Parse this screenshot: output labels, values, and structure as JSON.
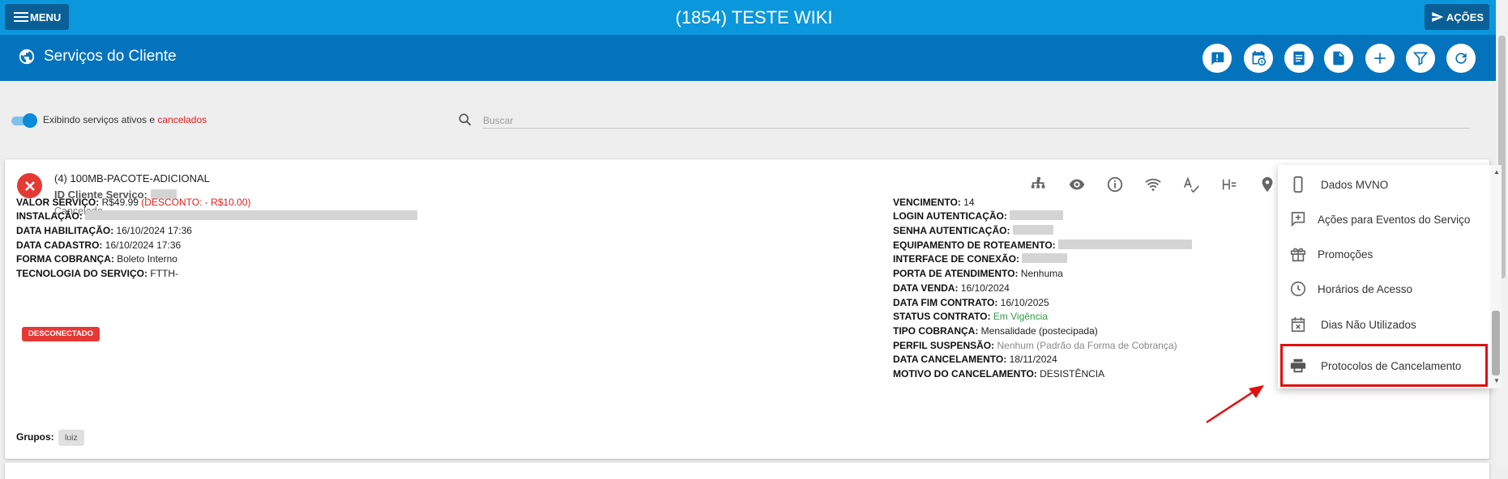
{
  "app": {
    "title": "(1854) TESTE WIKI",
    "menu_label": "MENU",
    "actions_label": "AÇÕES"
  },
  "page": {
    "title": "Serviços do Cliente"
  },
  "header_actions": [
    "alert-comment-icon",
    "calendar-clock-icon",
    "notes-icon",
    "document-icon",
    "add-icon",
    "filter-icon",
    "refresh-icon"
  ],
  "filter": {
    "toggle_text": "Exibindo serviços ativos e ",
    "toggle_text_highlight": "cancelados",
    "toggle_on": true
  },
  "search": {
    "placeholder": "Buscar"
  },
  "service": {
    "name": "(4) 100MB-PACOTE-ADICIONAL",
    "id_label": "ID Cliente Serviço:",
    "status": "Cancelado",
    "badge": "DESCONECTADO",
    "groups_label": "Grupos:",
    "groups": [
      "luiz"
    ],
    "card_actions": [
      "network-tree-icon",
      "eye-icon",
      "info-icon",
      "wifi-icon",
      "spellcheck-icon",
      "format-header-icon",
      "map-marker-icon"
    ],
    "left_fields": [
      {
        "label": "VALOR SERVIÇO:",
        "value": "R$49.99",
        "extra": "(DESCONTO: - R$10.00)"
      },
      {
        "label": "INSTALAÇÃO:",
        "value": ""
      },
      {
        "label": "DATA HABILITAÇÃO:",
        "value": "16/10/2024 17:36"
      },
      {
        "label": "DATA CADASTRO:",
        "value": "16/10/2024 17:36"
      },
      {
        "label": "FORMA COBRANÇA:",
        "value": "Boleto Interno"
      },
      {
        "label": "TECNOLOGIA DO SERVIÇO:",
        "value": "FTTH-"
      }
    ],
    "right_fields": [
      {
        "label": "VENCIMENTO:",
        "value": "14"
      },
      {
        "label": "LOGIN AUTENTICAÇÃO:",
        "value": ""
      },
      {
        "label": "SENHA AUTENTICAÇÃO:",
        "value": ""
      },
      {
        "label": "EQUIPAMENTO DE ROTEAMENTO:",
        "value": ""
      },
      {
        "label": "INTERFACE DE CONEXÃO:",
        "value": ""
      },
      {
        "label": "PORTA DE ATENDIMENTO:",
        "value": "Nenhuma"
      },
      {
        "label": "DATA VENDA:",
        "value": "16/10/2024"
      },
      {
        "label": "DATA FIM CONTRATO:",
        "value": "16/10/2025"
      },
      {
        "label": "STATUS CONTRATO:",
        "value": "Em Vigência"
      },
      {
        "label": "TIPO COBRANÇA:",
        "value": "Mensalidade (postecipada)"
      },
      {
        "label": "PERFIL SUSPENSÃO:",
        "value": "Nenhum (Padrão da Forma de Cobrança)"
      },
      {
        "label": "DATA CANCELAMENTO:",
        "value": "18/11/2024"
      },
      {
        "label": "MOTIVO DO CANCELAMENTO:",
        "value": "DESISTÊNCIA"
      }
    ]
  },
  "dropdown": {
    "items": [
      {
        "label": "Dados MVNO",
        "icon": "cellphone-icon"
      },
      {
        "label": "Ações para Eventos do Serviço",
        "icon": "message-plus-icon"
      },
      {
        "label": "Promoções",
        "icon": "gift-icon"
      },
      {
        "label": "Horários de Acesso",
        "icon": "clock-icon"
      },
      {
        "label": "Dias Não Utilizados",
        "icon": "calendar-remove-icon"
      },
      {
        "label": "Protocolos de Cancelamento",
        "icon": "printer-icon"
      }
    ],
    "highlighted_item": "Protocolos de Cancelamento"
  },
  "colors": {
    "topbar": "#0b97dc",
    "header": "#0473bd",
    "danger": "#e53935",
    "highlight": "#e01010",
    "success": "#2ea043"
  }
}
